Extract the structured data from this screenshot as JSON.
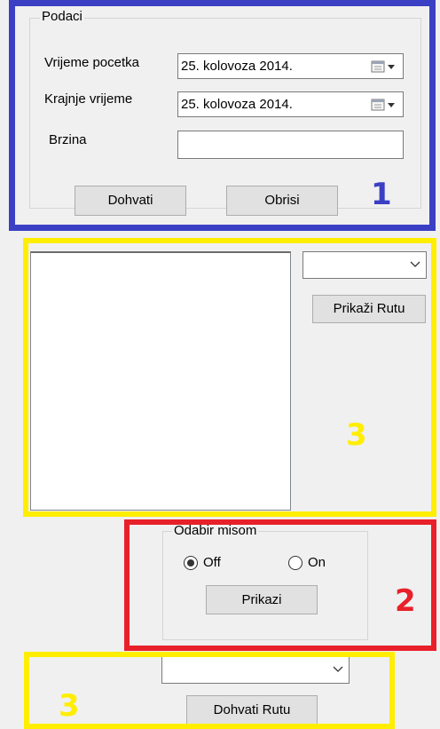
{
  "podaci": {
    "legend": "Podaci",
    "start_label": "Vrijeme pocetka",
    "start_value": "25. kolovoza 2014.",
    "end_label": "Krajnje vrijeme",
    "end_value": "25. kolovoza 2014.",
    "speed_label": "Brzina",
    "speed_value": "",
    "fetch_button": "Dohvati",
    "delete_button": "Obrisi"
  },
  "route_panel": {
    "list_items": [],
    "route_select_value": "",
    "show_route_button": "Prikaži Rutu"
  },
  "mouse_select": {
    "legend": "Odabir misom",
    "off_label": "Off",
    "on_label": "On",
    "selected": "Off",
    "show_button": "Prikazi"
  },
  "bottom": {
    "route_select_value": "",
    "fetch_route_button": "Dohvati Rutu"
  },
  "annotations": {
    "blue_number": "1",
    "yellow_number_top": "3",
    "red_number": "2",
    "yellow_number_bottom": "3"
  },
  "colors": {
    "blue": "#3b3fc4",
    "yellow": "#ffee00",
    "red": "#e8202a"
  }
}
